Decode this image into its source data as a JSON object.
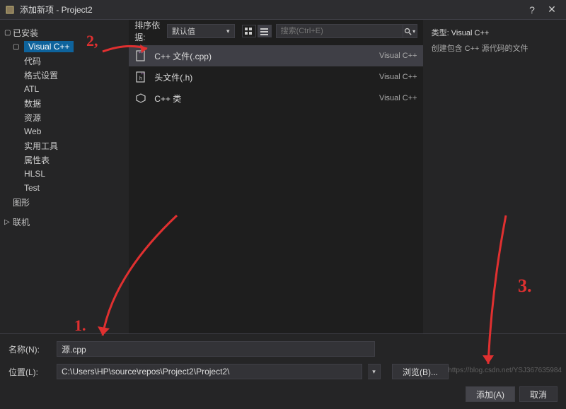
{
  "title": "添加新项 - Project2",
  "sidebar": {
    "installed_label": "已安装",
    "root": {
      "label": "Visual C++"
    },
    "children": [
      "代码",
      "格式设置",
      "ATL",
      "数据",
      "资源",
      "Web",
      "实用工具",
      "属性表",
      "HLSL",
      "Test"
    ],
    "graphics": "图形",
    "online": "联机"
  },
  "toolbar": {
    "sort_label": "排序依据:",
    "sort_value": "默认值",
    "search_placeholder": "搜索(Ctrl+E)"
  },
  "items": [
    {
      "label": "C++ 文件(.cpp)",
      "lang": "Visual C++"
    },
    {
      "label": "头文件(.h)",
      "lang": "Visual C++"
    },
    {
      "label": "C++ 类",
      "lang": "Visual C++"
    }
  ],
  "details": {
    "type_label": "类型:",
    "type_value": "Visual C++",
    "desc": "创建包含 C++ 源代码的文件"
  },
  "form": {
    "name_label": "名称(N):",
    "name_value": "源.cpp",
    "location_label": "位置(L):",
    "location_value": "C:\\Users\\HP\\source\\repos\\Project2\\Project2\\",
    "browse": "浏览(B)...",
    "add": "添加(A)",
    "cancel": "取消"
  },
  "annotations": {
    "one": "1.",
    "two": "2,",
    "three": "3."
  },
  "watermark": "https://blog.csdn.net/YSJ367635984"
}
